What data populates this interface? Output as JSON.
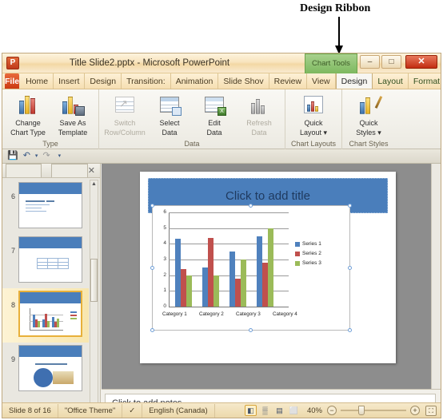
{
  "annotation": {
    "label": "Design Ribbon"
  },
  "window": {
    "title": "Title Slide2.pptx  -  Microsoft PowerPoint",
    "app_logo": "P",
    "contextual_tab": "Chart Tools",
    "controls": {
      "minimize": "–",
      "maximize": "□",
      "close": "✕"
    }
  },
  "tabs": {
    "file": "File",
    "items": [
      {
        "label": "Home",
        "active": false,
        "contextual": false
      },
      {
        "label": "Insert",
        "active": false,
        "contextual": false
      },
      {
        "label": "Design",
        "active": false,
        "contextual": false
      },
      {
        "label": "Transition:",
        "active": false,
        "contextual": false
      },
      {
        "label": "Animation",
        "active": false,
        "contextual": false
      },
      {
        "label": "Slide Shov",
        "active": false,
        "contextual": false
      },
      {
        "label": "Review",
        "active": false,
        "contextual": false
      },
      {
        "label": "View",
        "active": false,
        "contextual": false
      },
      {
        "label": "Design",
        "active": true,
        "contextual": true
      },
      {
        "label": "Layout",
        "active": false,
        "contextual": true
      },
      {
        "label": "Format",
        "active": false,
        "contextual": true
      }
    ],
    "help_glyph": "?",
    "minimize_ribbon_glyph": "⌃"
  },
  "ribbon": {
    "groups": [
      {
        "label": "Type",
        "buttons": [
          {
            "line1": "Change",
            "line2": "Chart Type",
            "icon": "change-chart-type-icon",
            "disabled": false
          },
          {
            "line1": "Save As",
            "line2": "Template",
            "icon": "save-as-template-icon",
            "disabled": false
          }
        ]
      },
      {
        "label": "Data",
        "buttons": [
          {
            "line1": "Switch",
            "line2": "Row/Column",
            "icon": "switch-row-column-icon",
            "disabled": true
          },
          {
            "line1": "Select",
            "line2": "Data",
            "icon": "select-data-icon",
            "disabled": false
          },
          {
            "line1": "Edit",
            "line2": "Data",
            "icon": "edit-data-icon",
            "disabled": false
          },
          {
            "line1": "Refresh",
            "line2": "Data",
            "icon": "refresh-data-icon",
            "disabled": true
          }
        ]
      },
      {
        "label": "Chart Layouts",
        "buttons": [
          {
            "line1": "Quick",
            "line2": "Layout ▾",
            "icon": "quick-layout-icon",
            "disabled": false
          }
        ]
      },
      {
        "label": "Chart Styles",
        "buttons": [
          {
            "line1": "Quick",
            "line2": "Styles ▾",
            "icon": "quick-styles-icon",
            "disabled": false
          }
        ]
      }
    ]
  },
  "quick_access": [
    {
      "name": "save-icon",
      "glyph": "💾",
      "disabled": false
    },
    {
      "name": "undo-icon",
      "glyph": "↶",
      "disabled": false
    },
    {
      "name": "undo-dropdown-icon",
      "glyph": "▾",
      "disabled": false
    },
    {
      "name": "redo-icon",
      "glyph": "↷",
      "disabled": true
    },
    {
      "name": "customize-qat-icon",
      "glyph": "▾",
      "disabled": false
    }
  ],
  "slide_panel": {
    "tab_slides": "",
    "tab_outline": "",
    "close_glyph": "✕",
    "scroll_up_glyph": "▲",
    "scroll_down_glyph": "▼",
    "thumbnails": [
      {
        "number": "6",
        "selected": false,
        "kind": "text-lines"
      },
      {
        "number": "7",
        "selected": false,
        "kind": "table"
      },
      {
        "number": "8",
        "selected": true,
        "kind": "chart"
      },
      {
        "number": "9",
        "selected": false,
        "kind": "picture"
      }
    ]
  },
  "slide": {
    "title_placeholder": "Click to add title",
    "notes_placeholder": "Click to add notes"
  },
  "chart_data": {
    "type": "bar",
    "title": "",
    "categories": [
      "Category 1",
      "Category 2",
      "Category 3",
      "Category 4"
    ],
    "series": [
      {
        "name": "Series 1",
        "color": "#4f81bd",
        "values": [
          4.3,
          2.5,
          3.5,
          4.5
        ]
      },
      {
        "name": "Series 2",
        "color": "#c0504d",
        "values": [
          2.4,
          4.4,
          1.8,
          2.8
        ]
      },
      {
        "name": "Series 3",
        "color": "#9bbb59",
        "values": [
          2,
          2,
          3,
          5
        ]
      }
    ],
    "ylim": [
      0,
      6
    ],
    "yticks": [
      0,
      1,
      2,
      3,
      4,
      5,
      6
    ],
    "xlabel": "",
    "ylabel": "",
    "grid": true,
    "legend_position": "right"
  },
  "status_bar": {
    "slide_count": "Slide 8 of 16",
    "theme": "\"Office Theme\"",
    "spellcheck_icon": "spellcheck-icon",
    "language": "English (Canada)",
    "views": [
      {
        "name": "view-normal",
        "glyph": "◧",
        "active": true
      },
      {
        "name": "view-slide-sorter",
        "glyph": "▒",
        "active": false
      },
      {
        "name": "view-reading",
        "glyph": "▤",
        "active": false
      },
      {
        "name": "view-slideshow",
        "glyph": "⬜",
        "active": false
      }
    ],
    "zoom_level": "40%",
    "zoom_out_glyph": "−",
    "zoom_in_glyph": "+",
    "fit_glyph": "⛶"
  }
}
